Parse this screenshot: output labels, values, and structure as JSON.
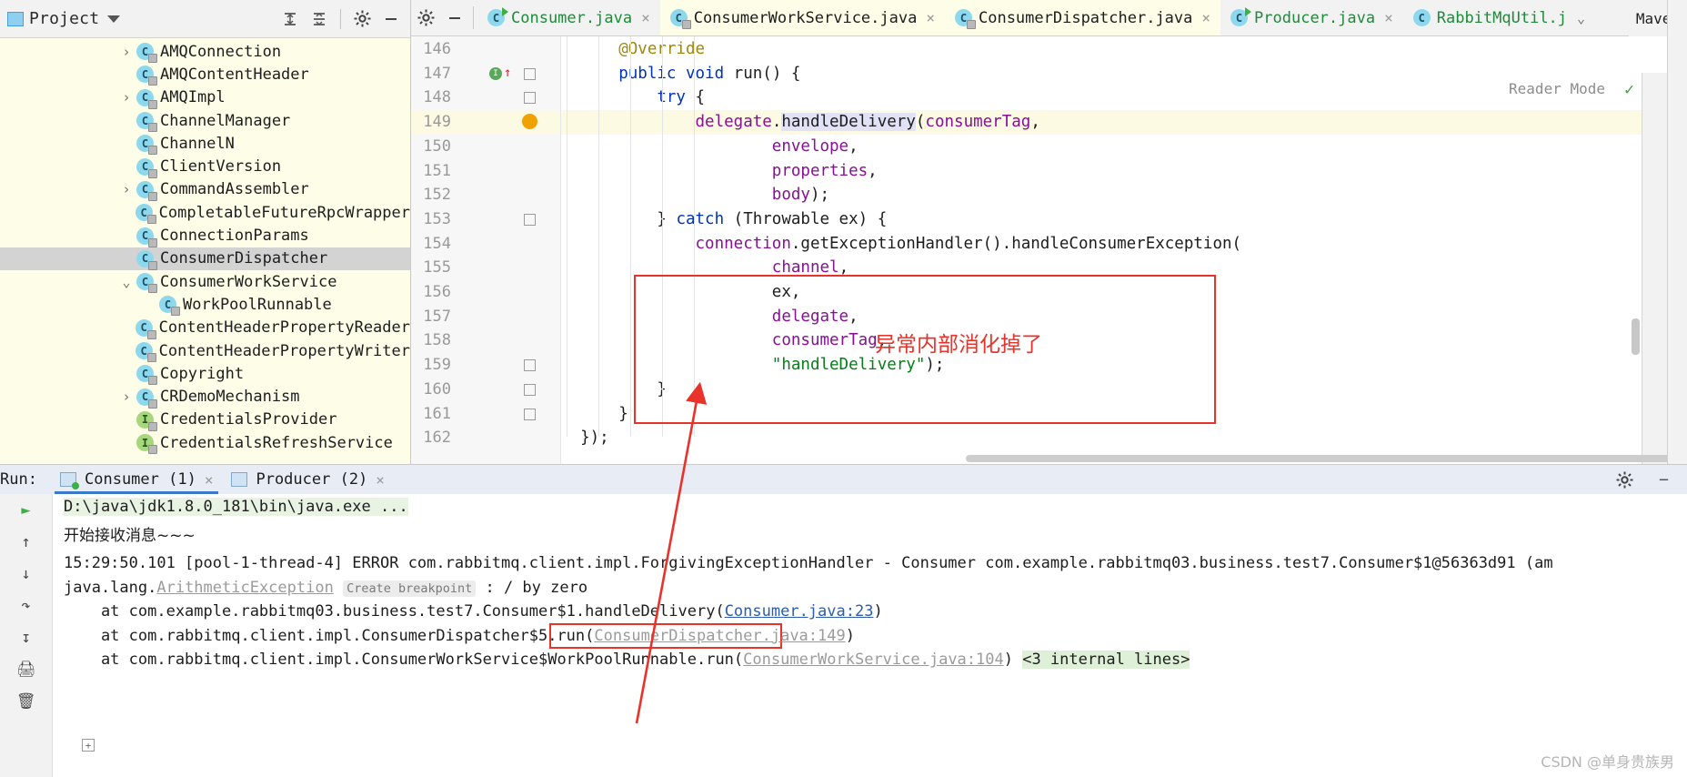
{
  "project_panel": {
    "title": "Project",
    "icons": [
      "expand-all-icon",
      "collapse-all-icon",
      "settings-gear-icon",
      "hide-panel-icon"
    ],
    "tree_items": [
      {
        "label": "AMQConnection",
        "kind": "class",
        "twisty": "›",
        "indent": 130,
        "selected": false
      },
      {
        "label": "AMQContentHeader",
        "kind": "class",
        "twisty": "",
        "indent": 130,
        "selected": false
      },
      {
        "label": "AMQImpl",
        "kind": "class",
        "twisty": "›",
        "indent": 130,
        "selected": false
      },
      {
        "label": "ChannelManager",
        "kind": "class",
        "twisty": "",
        "indent": 130,
        "selected": false
      },
      {
        "label": "ChannelN",
        "kind": "class",
        "twisty": "",
        "indent": 130,
        "selected": false
      },
      {
        "label": "ClientVersion",
        "kind": "class",
        "twisty": "",
        "indent": 130,
        "selected": false
      },
      {
        "label": "CommandAssembler",
        "kind": "class",
        "twisty": "›",
        "indent": 130,
        "selected": false
      },
      {
        "label": "CompletableFutureRpcWrapper",
        "kind": "class",
        "twisty": "",
        "indent": 130,
        "selected": false
      },
      {
        "label": "ConnectionParams",
        "kind": "class",
        "twisty": "",
        "indent": 130,
        "selected": false
      },
      {
        "label": "ConsumerDispatcher",
        "kind": "class",
        "twisty": "",
        "indent": 130,
        "selected": true
      },
      {
        "label": "ConsumerWorkService",
        "kind": "class",
        "twisty": "⌄",
        "indent": 130,
        "selected": false
      },
      {
        "label": "WorkPoolRunnable",
        "kind": "class",
        "twisty": "",
        "indent": 155,
        "selected": false
      },
      {
        "label": "ContentHeaderPropertyReader",
        "kind": "class",
        "twisty": "",
        "indent": 130,
        "selected": false
      },
      {
        "label": "ContentHeaderPropertyWriter",
        "kind": "class",
        "twisty": "",
        "indent": 130,
        "selected": false
      },
      {
        "label": "Copyright",
        "kind": "class",
        "twisty": "",
        "indent": 130,
        "selected": false
      },
      {
        "label": "CRDemoMechanism",
        "kind": "class",
        "twisty": "›",
        "indent": 130,
        "selected": false
      },
      {
        "label": "CredentialsProvider",
        "kind": "interface",
        "twisty": "",
        "indent": 130,
        "selected": false
      },
      {
        "label": "CredentialsRefreshService",
        "kind": "interface",
        "twisty": "",
        "indent": 130,
        "selected": false
      }
    ]
  },
  "editor": {
    "tabs": [
      {
        "label": "Consumer.java",
        "active": false,
        "color": "green",
        "icon": "class-run-icon",
        "closable": true
      },
      {
        "label": "ConsumerWorkService.java",
        "active": true,
        "color": "black",
        "icon": "class-lock-icon",
        "closable": true
      },
      {
        "label": "ConsumerDispatcher.java",
        "active": true,
        "color": "black",
        "icon": "class-lock-icon",
        "closable": true
      },
      {
        "label": "Producer.java",
        "active": false,
        "color": "green",
        "icon": "class-run-icon",
        "closable": true
      },
      {
        "label": "RabbitMqUtil.j",
        "active": false,
        "color": "green",
        "icon": "class-icon",
        "closable": false
      }
    ],
    "right_tool_label": "Maven",
    "reader_mode": "Reader Mode",
    "line_numbers": [
      "146",
      "147",
      "148",
      "149",
      "150",
      "151",
      "152",
      "153",
      "154",
      "155",
      "156",
      "157",
      "158",
      "159",
      "160",
      "161",
      "162"
    ],
    "code_lines": [
      {
        "n": "146",
        "indent": 3,
        "parts": [
          {
            "t": "@Override",
            "c": "ann"
          }
        ]
      },
      {
        "n": "147",
        "indent": 3,
        "parts": [
          {
            "t": "public ",
            "c": "kw"
          },
          {
            "t": "void ",
            "c": "kw"
          },
          {
            "t": "run() {",
            "c": "mth"
          }
        ]
      },
      {
        "n": "148",
        "indent": 5,
        "parts": [
          {
            "t": "try",
            "c": "kw"
          },
          {
            "t": " {",
            "c": "mth"
          }
        ]
      },
      {
        "n": "149",
        "indent": 7,
        "parts": [
          {
            "t": "delegate",
            "c": "fld"
          },
          {
            "t": ".",
            "c": "mth"
          },
          {
            "t": "handleDelivery",
            "c": "hl"
          },
          {
            "t": "(",
            "c": "mth"
          },
          {
            "t": "consumerTag",
            "c": "fld"
          },
          {
            "t": ",",
            "c": "mth"
          }
        ]
      },
      {
        "n": "150",
        "indent": 11,
        "parts": [
          {
            "t": "envelope",
            "c": "fld"
          },
          {
            "t": ",",
            "c": "mth"
          }
        ]
      },
      {
        "n": "151",
        "indent": 11,
        "parts": [
          {
            "t": "properties",
            "c": "fld"
          },
          {
            "t": ",",
            "c": "mth"
          }
        ]
      },
      {
        "n": "152",
        "indent": 11,
        "parts": [
          {
            "t": "body",
            "c": "fld"
          },
          {
            "t": ");",
            "c": "mth"
          }
        ]
      },
      {
        "n": "153",
        "indent": 5,
        "parts": [
          {
            "t": "} ",
            "c": "mth"
          },
          {
            "t": "catch ",
            "c": "kw"
          },
          {
            "t": "(Throwable ex) {",
            "c": "mth"
          }
        ]
      },
      {
        "n": "154",
        "indent": 7,
        "parts": [
          {
            "t": "connection",
            "c": "fld"
          },
          {
            "t": ".getExceptionHandler().handleConsumerException(",
            "c": "mth"
          }
        ]
      },
      {
        "n": "155",
        "indent": 11,
        "parts": [
          {
            "t": "channel",
            "c": "fld"
          },
          {
            "t": ",",
            "c": "mth"
          }
        ]
      },
      {
        "n": "156",
        "indent": 11,
        "parts": [
          {
            "t": "ex,",
            "c": "mth"
          }
        ]
      },
      {
        "n": "157",
        "indent": 11,
        "parts": [
          {
            "t": "delegate",
            "c": "fld"
          },
          {
            "t": ",",
            "c": "mth"
          }
        ]
      },
      {
        "n": "158",
        "indent": 11,
        "parts": [
          {
            "t": "consumerTag",
            "c": "fld"
          },
          {
            "t": ",",
            "c": "mth"
          }
        ]
      },
      {
        "n": "159",
        "indent": 11,
        "parts": [
          {
            "t": "\"handleDelivery\"",
            "c": "str"
          },
          {
            "t": ");",
            "c": "mth"
          }
        ]
      },
      {
        "n": "160",
        "indent": 5,
        "parts": [
          {
            "t": "}",
            "c": "mth"
          }
        ]
      },
      {
        "n": "161",
        "indent": 3,
        "parts": [
          {
            "t": "}",
            "c": "mth"
          }
        ]
      },
      {
        "n": "162",
        "indent": 1,
        "parts": [
          {
            "t": "});",
            "c": "mth"
          }
        ]
      }
    ],
    "annotation_note": "异常内部消化掉了",
    "annotation_color": "#e8322a"
  },
  "run_window": {
    "label": "Run:",
    "tabs": [
      {
        "label": "Consumer (1)",
        "active": true,
        "running": true
      },
      {
        "label": "Producer (2)",
        "active": false,
        "running": false
      }
    ],
    "toolbar_icons": [
      "rerun-icon",
      "up-arrow-icon",
      "down-arrow-icon",
      "soft-wrap-icon",
      "scroll-to-end-icon",
      "print-icon",
      "clear-all-icon"
    ],
    "gear_icon": "settings-gear-icon",
    "minimize_icon": "minimize-icon",
    "console_lines": [
      {
        "kind": "cmd",
        "text": "D:\\java\\jdk1.8.0_181\\bin\\java.exe ..."
      },
      {
        "kind": "cn",
        "text": "开始接收消息~~~"
      },
      {
        "kind": "error",
        "text": "15:29:50.101 [pool-1-thread-4] ERROR com.rabbitmq.client.impl.ForgivingExceptionHandler - Consumer com.example.rabbitmq03.business.test7.Consumer$1@56363d91 (am"
      },
      {
        "kind": "exc",
        "prefix": "java.lang.",
        "link": "ArithmeticException",
        "chip": "Create breakpoint",
        "suffix": " : / by zero"
      },
      {
        "kind": "frame",
        "prefix": "    at com.example.rabbitmq03.business.test7.Consumer$1.handleDelivery(",
        "link": "Consumer.java:23",
        "suffix": ")"
      },
      {
        "kind": "frame",
        "prefix": "    at com.rabbitmq.client.impl.ConsumerDispatcher$5.run(",
        "link": "ConsumerDispatcher.java:149",
        "suffix": ")",
        "boxed": true
      },
      {
        "kind": "frame2",
        "prefix": "    at com.rabbitmq.client.impl.ConsumerWorkService$WorkPoolRunnable.run(",
        "link": "ConsumerWorkService.java:104",
        "suffix": ")",
        "folded": "<3 internal lines>"
      }
    ]
  },
  "watermark": "CSDN @单身贵族男",
  "colors": {
    "accent_red": "#e8322a",
    "tab_active_bg": "#fdfde8",
    "tree_bg": "#fdfde8",
    "selection_gray": "#d3d3d3",
    "run_tab_underline": "#3c78c8",
    "keyword_blue": "#0033b3",
    "field_purple": "#871094",
    "string_green": "#067d17"
  }
}
